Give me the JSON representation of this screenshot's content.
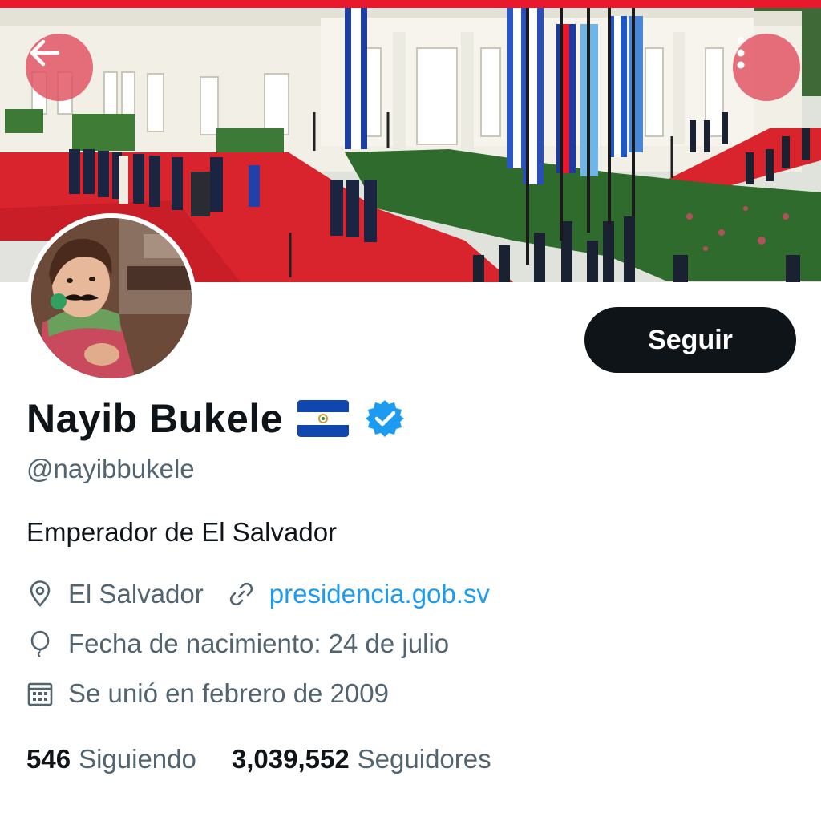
{
  "header": {
    "back_icon": "arrow-left-icon",
    "more_icon": "more-vertical-icon",
    "button_color": "#e25060"
  },
  "banner": {
    "description_icon": "banner-photo"
  },
  "profile": {
    "follow_label": "Seguir",
    "display_name": "Nayib Bukele",
    "flag_icon": "el-salvador-flag-icon",
    "verified_icon": "verified-badge-icon",
    "handle": "@nayibbukele",
    "bio": "Emperador de El Salvador",
    "location": "El Salvador",
    "website": "presidencia.gob.sv",
    "birthday": "Fecha de nacimiento: 24 de julio",
    "joined": "Se unió en febrero de 2009",
    "following_count": "546",
    "following_label": "Siguiendo",
    "followers_count": "3,039,552",
    "followers_label": "Seguidores"
  },
  "colors": {
    "accent": "#1d9bf0",
    "text_primary": "#0f1419",
    "text_secondary": "#536471",
    "follow_button_bg": "#0f1419"
  }
}
